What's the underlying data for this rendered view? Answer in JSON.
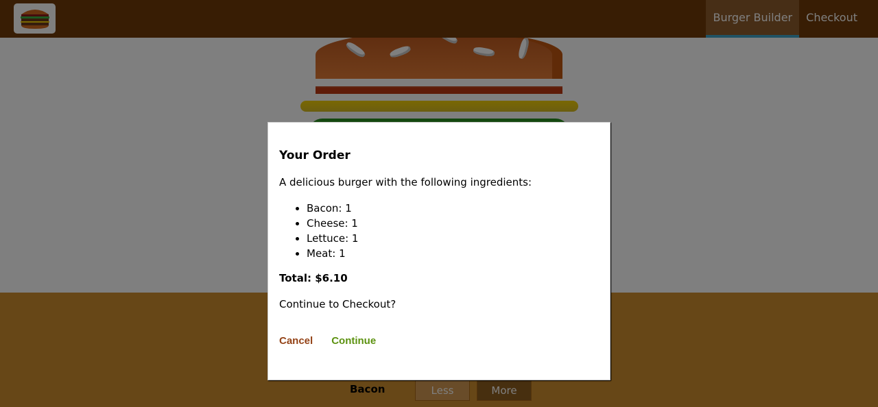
{
  "toolbar": {
    "logo_icon": "burger-logo-icon",
    "nav": [
      {
        "label": "Burger Builder",
        "active": true
      },
      {
        "label": "Checkout",
        "active": false
      }
    ]
  },
  "controls": {
    "ingredient_label": "Bacon",
    "less_label": "Less",
    "more_label": "More"
  },
  "modal": {
    "title": "Your Order",
    "intro": "A delicious burger with the following ingredients:",
    "ingredients": [
      "Bacon: 1",
      "Cheese: 1",
      "Lettuce: 1",
      "Meat: 1"
    ],
    "total": "Total: $6.10",
    "question": "Continue to Checkout?",
    "cancel_label": "Cancel",
    "continue_label": "Continue"
  },
  "colors": {
    "toolbar": "#703B09",
    "active_nav": "#8F5C2C",
    "controls_bg": "#CF8F2E",
    "cancel": "#944317",
    "continue": "#5C9210"
  }
}
